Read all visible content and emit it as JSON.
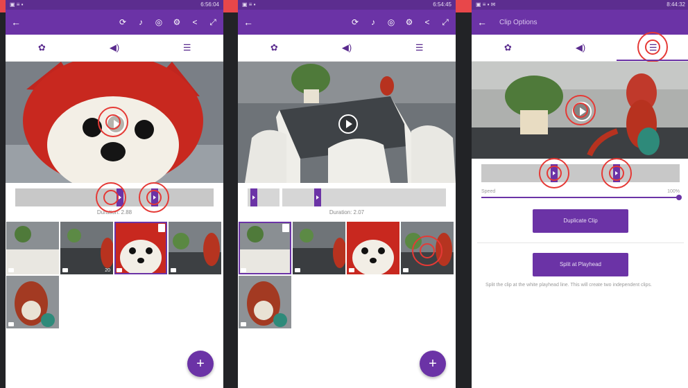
{
  "screens": [
    {
      "status_time": "6:56:04",
      "toolbar_icons": [
        "rotate-icon",
        "music-note-icon",
        "filter-icon",
        "gear-icon",
        "share-icon",
        "expand-icon"
      ],
      "tabs": [
        {
          "icon": "settings-icon"
        },
        {
          "icon": "volume-icon"
        },
        {
          "icon": "clip-options-icon"
        }
      ],
      "duration": "Duration: 2.88",
      "fab_label": "+"
    },
    {
      "status_time": "6:54:45",
      "toolbar_icons": [
        "rotate-icon",
        "music-note-icon",
        "filter-icon",
        "gear-icon",
        "share-icon",
        "expand-icon"
      ],
      "tabs": [
        {
          "icon": "settings-icon"
        },
        {
          "icon": "volume-icon"
        },
        {
          "icon": "clip-options-icon"
        }
      ],
      "duration": "Duration: 2.07",
      "fab_label": "+"
    },
    {
      "status_time": "8:44:32",
      "title": "Clip Options",
      "tabs": [
        {
          "icon": "settings-icon"
        },
        {
          "icon": "volume-icon"
        },
        {
          "icon": "clip-options-icon"
        }
      ],
      "speed_label": "Speed",
      "speed_value": "100%",
      "speed_level": 1.0,
      "duplicate_label": "Duplicate Clip",
      "split_label": "Split at Playhead",
      "help_text": "Split the clip at the white playhead line. This will create two independent clips."
    }
  ],
  "thumb_number": "20",
  "colors": {
    "accent": "#6b33a6",
    "annotation": "#e53935",
    "banner": "#e8474a"
  }
}
